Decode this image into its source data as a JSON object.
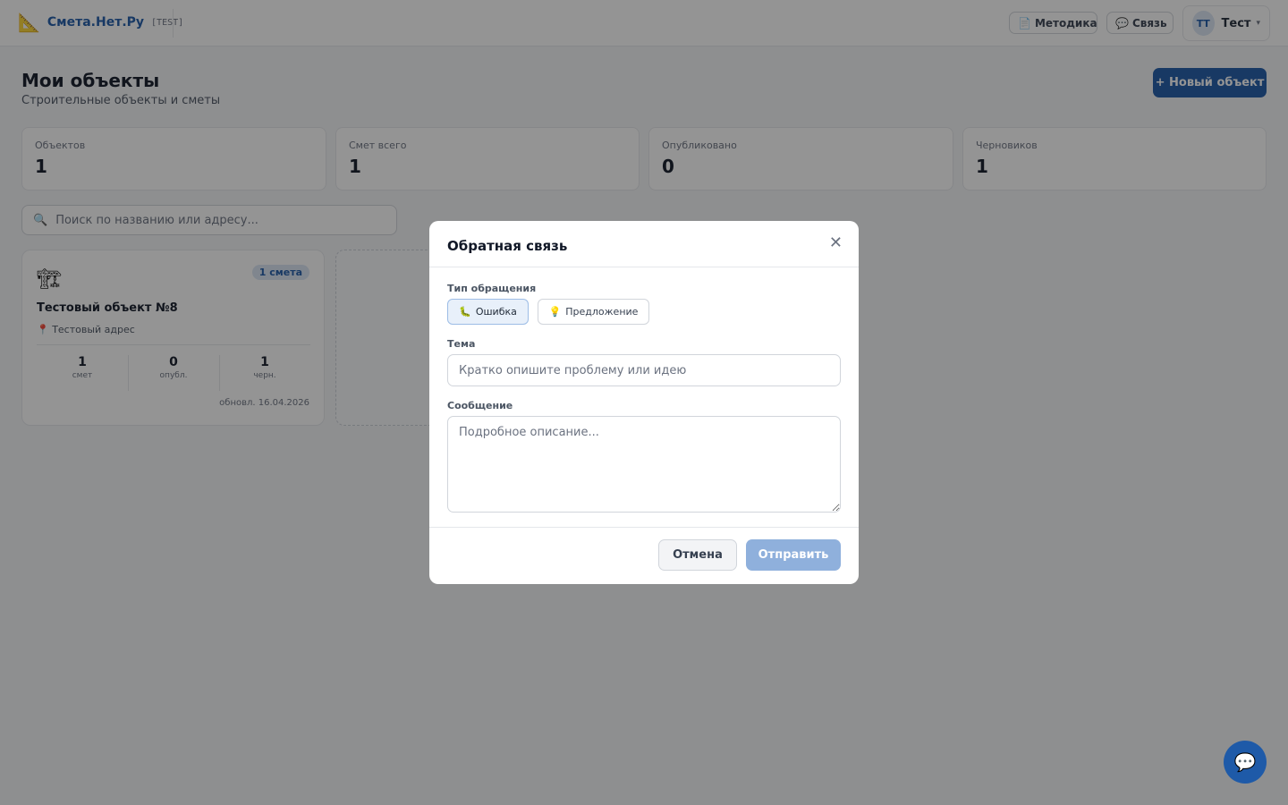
{
  "header": {
    "logo_icon": "triangle-ruler-icon",
    "logo_glyph": "📐",
    "app_name": "Смета.Нет.Ру",
    "env_tag": "[TEST]",
    "methodology_icon": "📄",
    "methodology_label": "Методика",
    "contact_icon": "💬",
    "contact_label": "Связь",
    "user_initials": "ТТ",
    "user_name": "Тест",
    "user_caret": "▾"
  },
  "page": {
    "title": "Мои объекты",
    "subtitle": "Строительные объекты и сметы",
    "new_object_label": "+ Новый объект"
  },
  "stats": [
    {
      "label": "Объектов",
      "value": "1"
    },
    {
      "label": "Смет всего",
      "value": "1"
    },
    {
      "label": "Опубликовано",
      "value": "0"
    },
    {
      "label": "Черновиков",
      "value": "1"
    }
  ],
  "search": {
    "icon": "🔍",
    "placeholder": "Поиск по названию или адресу..."
  },
  "object_card": {
    "icon": "🏗",
    "badge": "1 смета",
    "title": "Тестовый объект №8",
    "address": "📍 Тестовый адрес",
    "stats": [
      {
        "value": "1",
        "label": "смет"
      },
      {
        "value": "0",
        "label": "опубл."
      },
      {
        "value": "1",
        "label": "черн."
      }
    ],
    "updated": "обновл. 16.04.2026"
  },
  "modal": {
    "title": "Обратная связь",
    "close_glyph": "✕",
    "type_label": "Тип обращения",
    "type_options": [
      {
        "icon": "🐛",
        "label": "Ошибка",
        "selected": true
      },
      {
        "icon": "💡",
        "label": "Предложение",
        "selected": false
      }
    ],
    "topic_label": "Тема",
    "topic_placeholder": "Кратко опишите проблему или идею",
    "message_label": "Сообщение",
    "message_placeholder": "Подробное описание...",
    "cancel_label": "Отмена",
    "submit_label": "Отправить"
  },
  "chat_fab_glyph": "💬",
  "colors": {
    "accent": "#1e5aa8",
    "overlay": "rgba(17,17,17,0.45)",
    "submit_disabled": "#8fb0dc"
  }
}
